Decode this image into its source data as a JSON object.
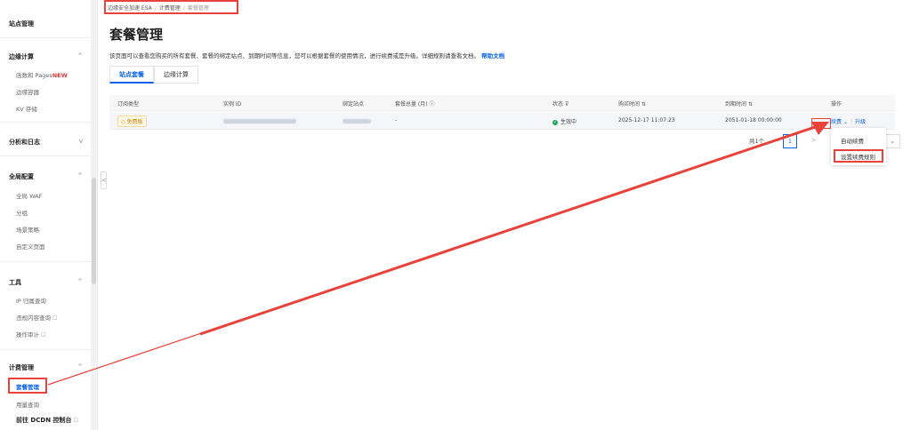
{
  "sidebar": {
    "top_item": "站点管理",
    "groups": [
      {
        "label": "边缘计算",
        "chevron": "^"
      },
      {
        "label": "分析和日志",
        "chevron": "v"
      },
      {
        "label": "全局配置",
        "chevron": "^"
      },
      {
        "label": "工具",
        "chevron": "^"
      },
      {
        "label": "计费管理",
        "chevron": "^"
      }
    ],
    "edge_items": [
      {
        "label": "函数和 Pages",
        "badge": "NEW"
      },
      {
        "label": "边缘容器"
      },
      {
        "label": "KV 存储"
      }
    ],
    "global_items": [
      "全局 WAF",
      "分组",
      "场景策略",
      "自定义页面"
    ],
    "tool_items": [
      {
        "label": "IP 归属查询",
        "ext": ""
      },
      {
        "label": "违规内容查询",
        "ext": "☐"
      },
      {
        "label": "操作审计",
        "ext": "☐"
      }
    ],
    "billing_items": [
      "套餐管理",
      "用量查询"
    ],
    "footer_link": "前往 DCDN 控制台",
    "footer_ext": "☐",
    "collapse_glyph": "<"
  },
  "breadcrumb": {
    "items": [
      "边缘安全加速 ESA",
      "计费管理",
      "套餐管理"
    ],
    "separator": "/"
  },
  "page": {
    "title": "套餐管理",
    "description": "该页面可以查看您购买的所有套餐、套餐的绑定站点、到期时间等信息，您可以根据套餐的使用情况，进行续费或是升级。详细规则请查看文档。",
    "help_link": "帮助文档"
  },
  "tabs": [
    "站点套餐",
    "边缘计算"
  ],
  "table": {
    "headers": {
      "type": "订阅类型",
      "instance": "实例 ID",
      "site": "绑定站点",
      "quota": "套餐总量 (月)",
      "status": "状态",
      "purchase": "购买时间",
      "expire": "到期时间",
      "ops": "操作"
    },
    "header_icons": {
      "quota": "ⓘ",
      "status": "⊽",
      "purchase": "⇅",
      "expire": "⇅"
    },
    "rows": [
      {
        "plan": "免费版",
        "plan_icon": "◇",
        "quota": "-",
        "status": "生效中",
        "status_icon": "✓",
        "purchase": "2025-12-17 11:07:23",
        "expire": "2051-01-18 00:00:00",
        "renew": "续费",
        "renew_chevron": "⌄",
        "upgrade": "升级"
      }
    ]
  },
  "pagination": {
    "total": "共1个",
    "current": "1",
    "prev": "<",
    "next": ">",
    "size_chevron": "⌄"
  },
  "dropdown": {
    "items": [
      "自动续费",
      "设置续费规则"
    ]
  },
  "colors": {
    "accent": "#0b63e5",
    "annotation": "#e8423b",
    "status_ok": "#22a655",
    "new_badge": "#e23b3b"
  }
}
